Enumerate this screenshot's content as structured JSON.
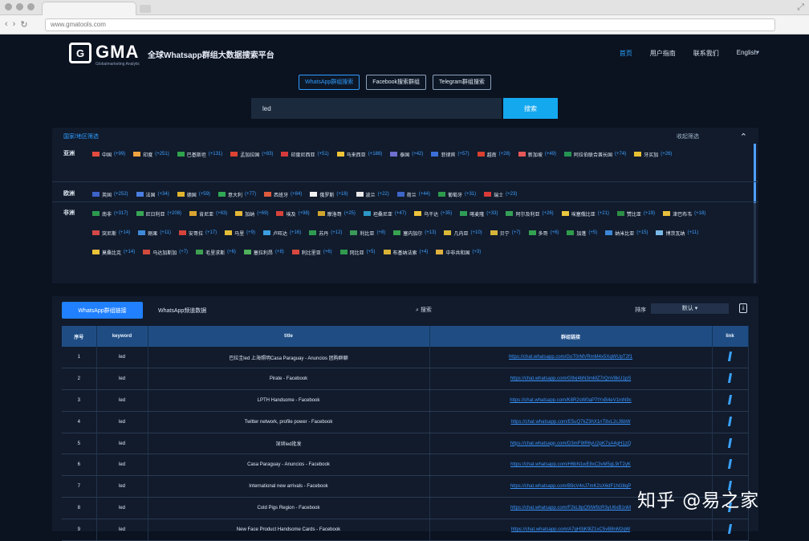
{
  "browser": {
    "address": "www.gmatools.com"
  },
  "site": {
    "logo": "GMA",
    "logo_sub": "Globalmarketing Analytic",
    "slogan": "全球Whatsapp群组大数据搜索平台",
    "nav": [
      "首页",
      "用户指南",
      "联系我们",
      "English"
    ]
  },
  "source_tabs": [
    "WhatsApp群组搜索",
    "Facebook搜索群组",
    "Telegram群组搜索"
  ],
  "search": {
    "query": "led",
    "button": "搜索"
  },
  "filters": {
    "title": "国家/地区筛选",
    "collapse_label": "收起筛选",
    "collapse_icon": "chevron-up-icon",
    "rows": [
      {
        "label": "亚洲",
        "items": [
          {
            "name": "中国",
            "count": "(+99)",
            "color": "#e34b3f"
          },
          {
            "name": "印度",
            "count": "(+251)",
            "color": "#f0a340"
          },
          {
            "name": "巴基斯坦",
            "count": "(+131)",
            "color": "#2fa24a"
          },
          {
            "name": "孟加拉国",
            "count": "(+83)",
            "color": "#db4332"
          },
          {
            "name": "印度尼西亚",
            "count": "(+51)",
            "color": "#d53a3a"
          },
          {
            "name": "马来西亚",
            "count": "(+188)",
            "color": "#f1c538"
          },
          {
            "name": "泰国",
            "count": "(+42)",
            "color": "#6e6fce"
          },
          {
            "name": "菲律宾",
            "count": "(+57)",
            "color": "#3c6fd8"
          },
          {
            "name": "越南",
            "count": "(+28)",
            "color": "#d94030"
          },
          {
            "name": "新加坡",
            "count": "(+49)",
            "color": "#e55858"
          },
          {
            "name": "阿拉伯联合酋长国",
            "count": "(+74)",
            "color": "#259453"
          },
          {
            "name": "牙买加",
            "count": "(+26)",
            "color": "#e6c034"
          }
        ]
      },
      {
        "label": "欧洲",
        "items": [
          {
            "name": "英国",
            "count": "(+252)",
            "color": "#3d62c8"
          },
          {
            "name": "法国",
            "count": "(+34)",
            "color": "#4a7fe0"
          },
          {
            "name": "德国",
            "count": "(+59)",
            "color": "#e1b42e"
          },
          {
            "name": "意大利",
            "count": "(+77)",
            "color": "#30a856"
          },
          {
            "name": "西班牙",
            "count": "(+84)",
            "color": "#e05a3d"
          },
          {
            "name": "俄罗斯",
            "count": "(+18)",
            "color": "#f0f0f0"
          },
          {
            "name": "波兰",
            "count": "(+22)",
            "color": "#e9e9e9"
          },
          {
            "name": "荷兰",
            "count": "(+44)",
            "color": "#3d65c7"
          },
          {
            "name": "葡萄牙",
            "count": "(+31)",
            "color": "#2d9a4c"
          },
          {
            "name": "瑞士",
            "count": "(+23)",
            "color": "#d93a3a"
          }
        ]
      },
      {
        "label": "非洲",
        "items": [
          {
            "name": "南非",
            "count": "(+317)",
            "color": "#2c9a4e"
          },
          {
            "name": "尼日利亚",
            "count": "(+208)",
            "color": "#38a655"
          },
          {
            "name": "肯尼亚",
            "count": "(+63)",
            "color": "#d9a430"
          },
          {
            "name": "加纳",
            "count": "(+69)",
            "color": "#e5b736"
          },
          {
            "name": "埃及",
            "count": "(+98)",
            "color": "#d8423a"
          },
          {
            "name": "摩洛哥",
            "count": "(+25)",
            "color": "#d1a52d"
          },
          {
            "name": "坦桑尼亚",
            "count": "(+47)",
            "color": "#2d98c6"
          },
          {
            "name": "乌干达",
            "count": "(+35)",
            "color": "#ecc33b"
          },
          {
            "name": "喀麦隆",
            "count": "(+33)",
            "color": "#2f9d56"
          },
          {
            "name": "阿尔及利亚",
            "count": "(+26)",
            "color": "#34a057"
          },
          {
            "name": "埃塞俄比亚",
            "count": "(+21)",
            "color": "#e9c73e"
          },
          {
            "name": "赞比亚",
            "count": "(+19)",
            "color": "#2b8f46"
          },
          {
            "name": "津巴布韦",
            "count": "(+18)",
            "color": "#e7bf3d"
          },
          {
            "name": "突尼斯",
            "count": "(+14)",
            "color": "#d54848"
          },
          {
            "name": "刚果",
            "count": "(+11)",
            "color": "#3f8ad8"
          },
          {
            "name": "安哥拉",
            "count": "(+17)",
            "color": "#d5433b"
          },
          {
            "name": "马里",
            "count": "(+9)",
            "color": "#e5be38"
          },
          {
            "name": "卢旺达",
            "count": "(+16)",
            "color": "#3c9fe0"
          },
          {
            "name": "苏丹",
            "count": "(+12)",
            "color": "#2f9b51"
          },
          {
            "name": "利比亚",
            "count": "(+8)",
            "color": "#3a9859"
          },
          {
            "name": "塞内加尔",
            "count": "(+13)",
            "color": "#38a34f"
          },
          {
            "name": "几内亚",
            "count": "(+10)",
            "color": "#d9b837"
          },
          {
            "name": "贝宁",
            "count": "(+7)",
            "color": "#d4b33a"
          },
          {
            "name": "多哥",
            "count": "(+6)",
            "color": "#33a150"
          },
          {
            "name": "加蓬",
            "count": "(+5)",
            "color": "#2f9b4b"
          },
          {
            "name": "纳米比亚",
            "count": "(+15)",
            "color": "#3d86d6"
          },
          {
            "name": "博茨瓦纳",
            "count": "(+11)",
            "color": "#79b9e8"
          },
          {
            "name": "莫桑比克",
            "count": "(+14)",
            "color": "#e9c238"
          },
          {
            "name": "马达加斯加",
            "count": "(+7)",
            "color": "#d24a3c"
          },
          {
            "name": "毛里求斯",
            "count": "(+6)",
            "color": "#3e9f51"
          },
          {
            "name": "塞拉利昂",
            "count": "(+8)",
            "color": "#50b05b"
          },
          {
            "name": "利比里亚",
            "count": "(+6)",
            "color": "#d9473f"
          },
          {
            "name": "冈比亚",
            "count": "(+5)",
            "color": "#2f9a4d"
          },
          {
            "name": "布基纳法索",
            "count": "(+4)",
            "color": "#d9b236"
          },
          {
            "name": "中非共和国",
            "count": "(+3)",
            "color": "#e0b13e"
          }
        ]
      }
    ]
  },
  "table": {
    "tab_active": "WhatsApp群组链接",
    "tab_secondary": "WhatsApp频道数据",
    "search_label": "搜索",
    "sort_label": "排序",
    "sort_value": "默认",
    "columns": [
      "序号",
      "keyword",
      "title",
      "群组链接",
      "link"
    ],
    "rows": [
      {
        "index": "1",
        "keyword": "led",
        "title": "巴拉圭led 上海照明Casa Paraguay - Anuncios 团购群聊",
        "link": "https://chat.whatsapp.com/GoT0rMVRmM4x5XqWUpT2f1"
      },
      {
        "index": "2",
        "keyword": "led",
        "title": "Pirate - Facebook",
        "link": "https://chat.whatsapp.com/G9xj4bN3mMZ7rQnV8kU1pS"
      },
      {
        "index": "3",
        "keyword": "led",
        "title": "LPTH Handsome - Facebook",
        "link": "https://chat.whatsapp.com/K8R2sW0aP7tYxB4eV1mN9c"
      },
      {
        "index": "4",
        "keyword": "led",
        "title": "Twitter network, profile power - Facebook",
        "link": "https://chat.whatsapp.com/E5uQ7kZ3hX1nT8vL2cJ6bW"
      },
      {
        "index": "5",
        "keyword": "led",
        "title": "深圳led批发",
        "link": "https://chat.whatsapp.com/D3mF9tR6yU2pK7sA4gH1zQ"
      },
      {
        "index": "6",
        "keyword": "led",
        "title": "Casa Paraguay - Anuncios - Facebook",
        "link": "https://chat.whatsapp.com/H6bN1wE8xC3vM5qL9rT2yK"
      },
      {
        "index": "7",
        "keyword": "led",
        "title": "International new arrivals - Facebook",
        "link": "https://chat.whatsapp.com/B9cV4nJ7mK2sX6dF1hG8qP"
      },
      {
        "index": "8",
        "keyword": "led",
        "title": "Cold Pigs Region - Facebook",
        "link": "https://chat.whatsapp.com/F2kL8pQ5tW9zR3yU6xB1nM"
      },
      {
        "index": "9",
        "keyword": "led",
        "title": "New Face Product Handsome Cards - Facebook",
        "link": "https://chat.whatsapp.com/A7gH3jK9lZ1xC5vB8nM2qW"
      }
    ]
  },
  "watermark": "知乎 @易之家"
}
